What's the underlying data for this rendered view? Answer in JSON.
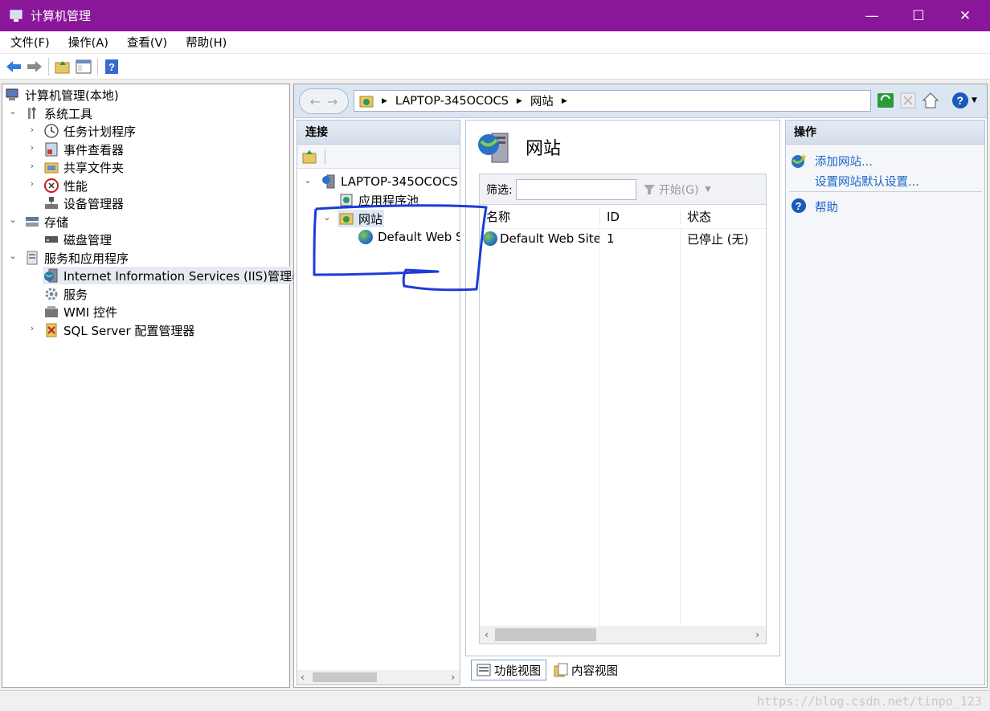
{
  "window": {
    "title": "计算机管理",
    "minimize": "—",
    "maximize": "☐",
    "close": "✕"
  },
  "menu": [
    "文件(F)",
    "操作(A)",
    "查看(V)",
    "帮助(H)"
  ],
  "left_tree": {
    "root": "计算机管理(本地)",
    "system_tools": "系统工具",
    "task_scheduler": "任务计划程序",
    "event_viewer": "事件查看器",
    "shared_folders": "共享文件夹",
    "performance": "性能",
    "device_manager": "设备管理器",
    "storage": "存储",
    "disk_mgmt": "磁盘管理",
    "services_apps": "服务和应用程序",
    "iis": "Internet Information Services (IIS)管理器",
    "services": "服务",
    "wmi": "WMI 控件",
    "sql": "SQL Server 配置管理器"
  },
  "iis": {
    "breadcrumb": [
      "LAPTOP-345OCOCS",
      "网站"
    ],
    "connections": {
      "header": "连接",
      "server": "LAPTOP-345OCOCS",
      "app_pools": "应用程序池",
      "sites": "网站",
      "default_site": "Default Web S"
    },
    "center": {
      "title": "网站",
      "filter_label": "筛选:",
      "filter_value": "",
      "start_label": "开始(G)",
      "columns": [
        "名称",
        "ID",
        "状态"
      ],
      "rows": [
        {
          "name": "Default Web Site",
          "id": "1",
          "status": "已停止 (无)"
        }
      ]
    },
    "actions": {
      "header": "操作",
      "add_site": "添加网站...",
      "set_defaults": "设置网站默认设置...",
      "help": "帮助"
    },
    "tabs": [
      "功能视图",
      "内容视图"
    ]
  },
  "watermark": "https://blog.csdn.net/tinpo_123",
  "colors": {
    "titlebar": "#8a179a",
    "link": "#1a64c8",
    "annotation": "#1c3cd8"
  }
}
